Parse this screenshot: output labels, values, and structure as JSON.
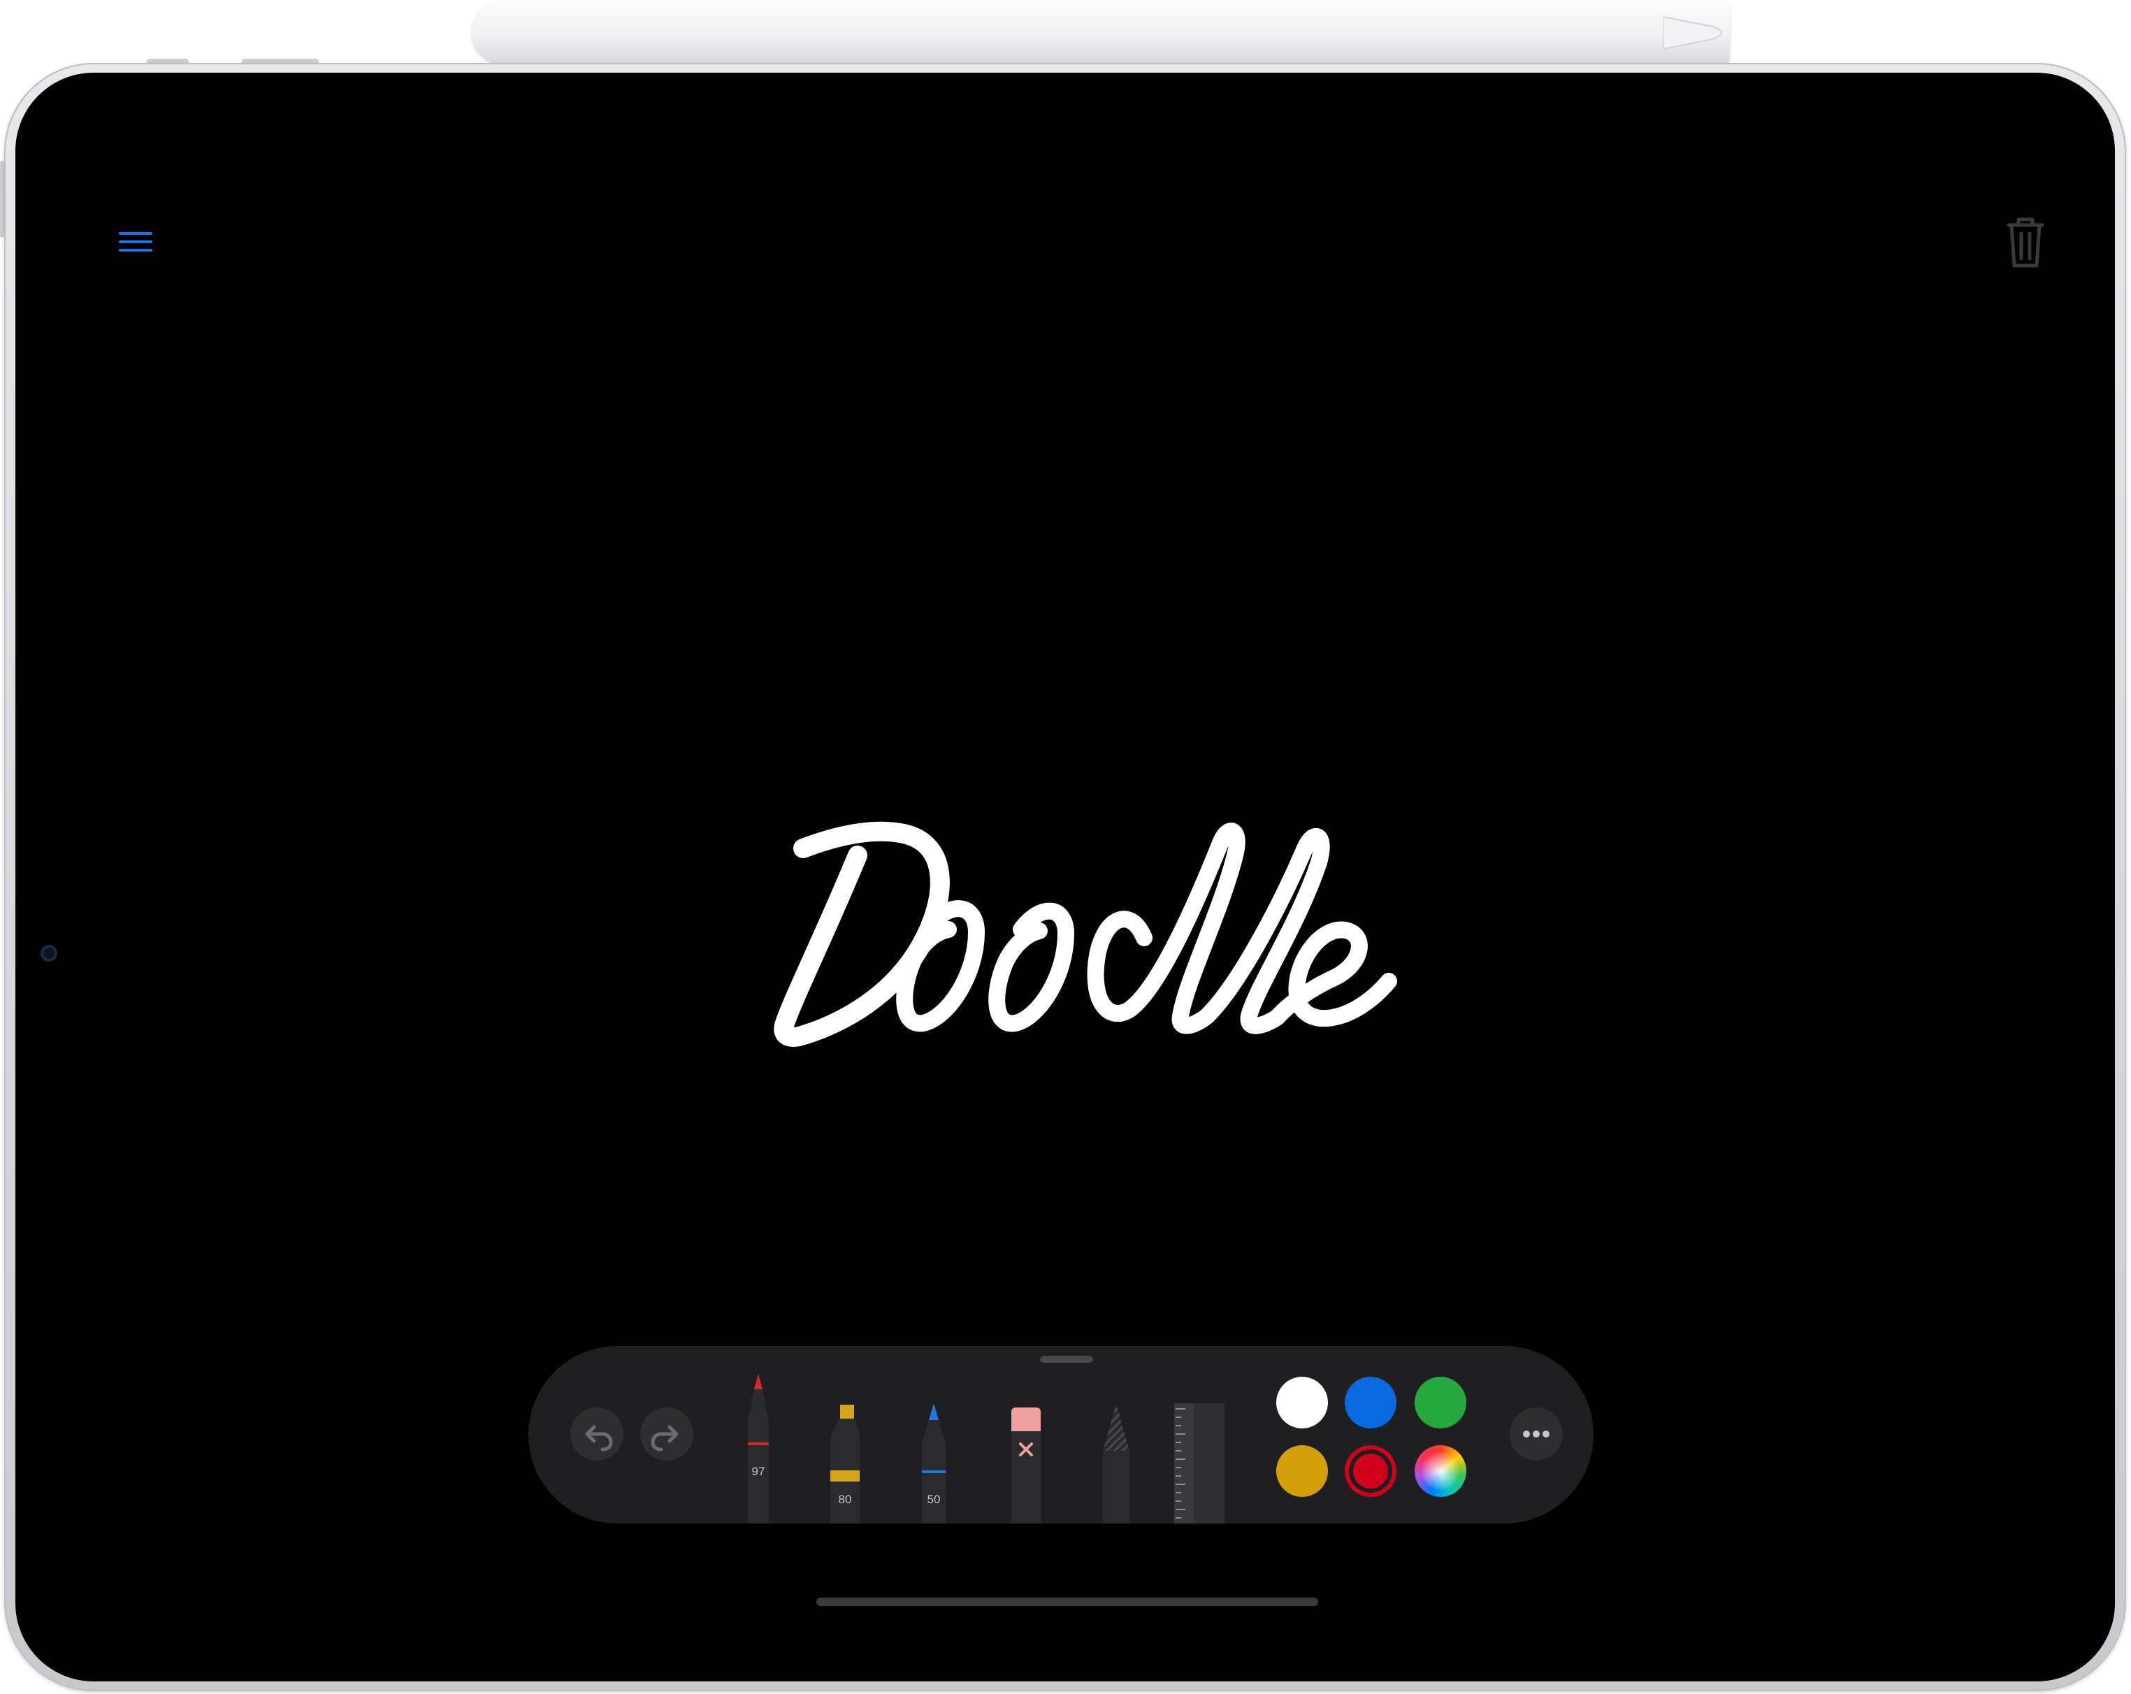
{
  "app": {
    "canvas_text": "Doodle"
  },
  "toolbar": {
    "tools": [
      {
        "name": "pen",
        "label": "97",
        "accent": "#d12a2a"
      },
      {
        "name": "marker",
        "label": "80",
        "accent": "#d4a41b"
      },
      {
        "name": "pencil",
        "label": "50",
        "accent": "#1f7ae0"
      },
      {
        "name": "eraser",
        "label": "",
        "accent": "#f0a0a0"
      },
      {
        "name": "lasso",
        "label": "",
        "accent": "#6c6c70"
      },
      {
        "name": "ruler",
        "label": "",
        "accent": "#3a3a3c"
      }
    ],
    "colors": {
      "white": "#ffffff",
      "blue": "#0a6be0",
      "green": "#25a83d",
      "yellow": "#d4a00a",
      "red": "#d1001c",
      "selected": "red"
    }
  },
  "colors": {
    "accent": "#1a73e8",
    "icon_inactive": "#3a3a3c",
    "screen": "#000000"
  }
}
